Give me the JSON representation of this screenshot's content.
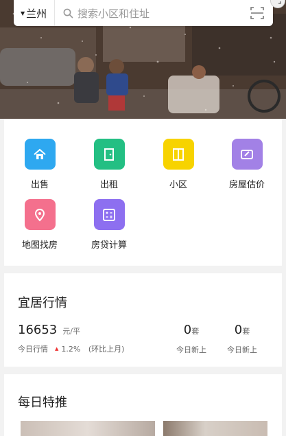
{
  "search": {
    "city": "兰州",
    "placeholder": "搜索小区和住址"
  },
  "icons": {
    "caret": "caret-down-icon",
    "search": "search-icon",
    "scan": "scan-icon",
    "corner": "expand-icon"
  },
  "quick_menu": [
    {
      "label": "出售",
      "icon": "home-icon",
      "color": "#2ea8f0"
    },
    {
      "label": "出租",
      "icon": "door-icon",
      "color": "#23bf83"
    },
    {
      "label": "小区",
      "icon": "book-icon",
      "color": "#f7d300"
    },
    {
      "label": "房屋估价",
      "icon": "estimate-icon",
      "color": "#a281e6"
    },
    {
      "label": "地图找房",
      "icon": "map-pin-icon",
      "color": "#f4708d"
    },
    {
      "label": "房贷计算",
      "icon": "calculator-icon",
      "color": "#8d6ff0"
    }
  ],
  "market": {
    "title": "宜居行情",
    "price": "16653",
    "unit": "元/平",
    "today_label": "今日行情",
    "change": "1.2%",
    "compare": "(环比上月)",
    "new_listed_count": "0",
    "new_listed_unit": "套",
    "new_listed_label": "今日新上",
    "new_listed2_count": "0",
    "new_listed2_unit": "套",
    "new_listed2_label": "今日新上"
  },
  "daily": {
    "title": "每日特推"
  }
}
